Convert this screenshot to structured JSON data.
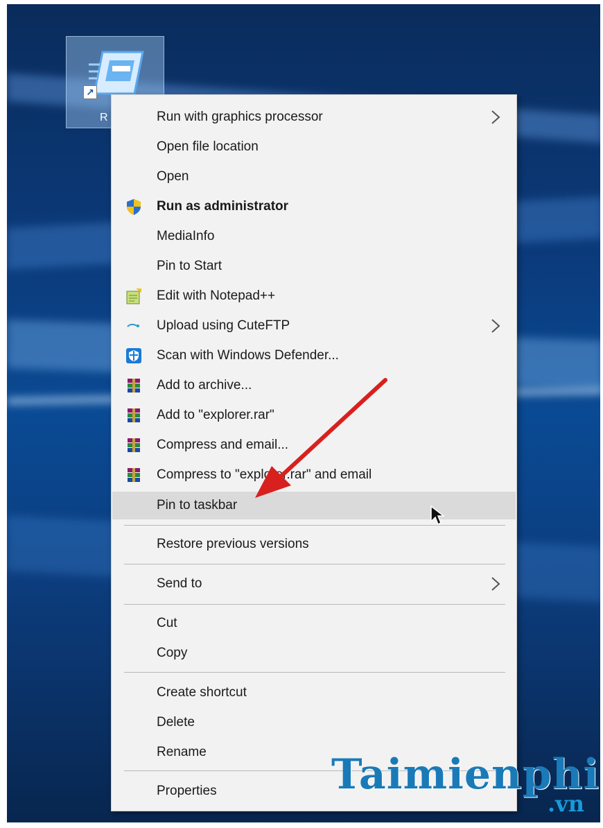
{
  "desktop": {
    "icon_label": "R",
    "shortcut_glyph": "↗"
  },
  "menu": {
    "items": [
      {
        "label": "Run with graphics processor",
        "icon": "",
        "submenu": true,
        "bold": false
      },
      {
        "label": "Open file location",
        "icon": "",
        "submenu": false,
        "bold": false
      },
      {
        "label": "Open",
        "icon": "",
        "submenu": false,
        "bold": false
      },
      {
        "label": "Run as administrator",
        "icon": "uac-shield-icon",
        "submenu": false,
        "bold": true
      },
      {
        "label": "MediaInfo",
        "icon": "",
        "submenu": false,
        "bold": false
      },
      {
        "label": "Pin to Start",
        "icon": "",
        "submenu": false,
        "bold": false
      },
      {
        "label": "Edit with Notepad++",
        "icon": "notepad-plus-plus-icon",
        "submenu": false,
        "bold": false
      },
      {
        "label": "Upload using CuteFTP",
        "icon": "cuteftp-icon",
        "submenu": true,
        "bold": false
      },
      {
        "label": "Scan with Windows Defender...",
        "icon": "windows-defender-icon",
        "submenu": false,
        "bold": false
      },
      {
        "label": "Add to archive...",
        "icon": "winrar-icon",
        "submenu": false,
        "bold": false
      },
      {
        "label": "Add to \"explorer.rar\"",
        "icon": "winrar-icon",
        "submenu": false,
        "bold": false
      },
      {
        "label": "Compress and email...",
        "icon": "winrar-icon",
        "submenu": false,
        "bold": false
      },
      {
        "label": "Compress to \"explorer.rar\" and email",
        "icon": "winrar-icon",
        "submenu": false,
        "bold": false
      },
      {
        "label": "Pin to taskbar",
        "icon": "",
        "submenu": false,
        "bold": false,
        "hovered": true
      },
      {
        "label": "Restore previous versions",
        "icon": "",
        "submenu": false,
        "bold": false
      },
      {
        "label": "Send to",
        "icon": "",
        "submenu": true,
        "bold": false
      },
      {
        "label": "Cut",
        "icon": "",
        "submenu": false,
        "bold": false
      },
      {
        "label": "Copy",
        "icon": "",
        "submenu": false,
        "bold": false
      },
      {
        "label": "Create shortcut",
        "icon": "",
        "submenu": false,
        "bold": false
      },
      {
        "label": "Delete",
        "icon": "",
        "submenu": false,
        "bold": false
      },
      {
        "label": "Rename",
        "icon": "",
        "submenu": false,
        "bold": false
      },
      {
        "label": "Properties",
        "icon": "",
        "submenu": false,
        "bold": false
      }
    ]
  },
  "watermark": {
    "brand": "Taimienphi",
    "suffix": ".vn"
  },
  "colors": {
    "menu_bg": "#f2f2f2",
    "hover_bg": "#dadada",
    "annotation_arrow": "#d8201e",
    "watermark": "#1a7ab8"
  }
}
